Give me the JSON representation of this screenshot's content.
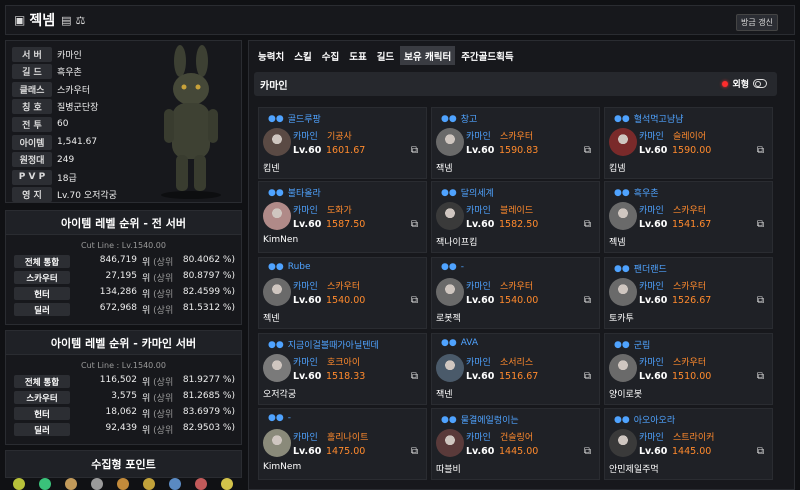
{
  "header": {
    "name": "젝넴",
    "refresh_label": "방금 갱신"
  },
  "profile": {
    "rows": [
      {
        "label": "서 버",
        "value": "카마인"
      },
      {
        "label": "길 드",
        "value": "흑우촌"
      },
      {
        "label": "클래스",
        "value": "스카우터"
      },
      {
        "label": "칭 호",
        "value": "질병군단장"
      },
      {
        "label": "전 투",
        "value": "60"
      },
      {
        "label": "아이템",
        "value": "1,541.67"
      },
      {
        "label": "원정대",
        "value": "249"
      },
      {
        "label": "P V P",
        "value": "18급"
      },
      {
        "label": "영 지",
        "value": "Lv.70 오저각궁"
      }
    ]
  },
  "rank_all": {
    "title": "아이템 레벨 순위 - 전 서버",
    "cutline": "Cut Line : Lv.1540.00",
    "rows": [
      {
        "label": "전체 통합",
        "value": "846,719",
        "unit": "위",
        "pre": "(상위",
        "pct": "80.4062 %)"
      },
      {
        "label": "스카우터",
        "value": "27,195",
        "unit": "위",
        "pre": "(상위",
        "pct": "80.8797 %)"
      },
      {
        "label": "헌터",
        "value": "134,286",
        "unit": "위",
        "pre": "(상위",
        "pct": "82.4599 %)"
      },
      {
        "label": "딜러",
        "value": "672,968",
        "unit": "위",
        "pre": "(상위",
        "pct": "81.5312 %)"
      }
    ]
  },
  "rank_server": {
    "title": "아이템 레벨 순위 - 카마인 서버",
    "cutline": "Cut Line : Lv.1540.00",
    "rows": [
      {
        "label": "전체 통합",
        "value": "116,502",
        "unit": "위",
        "pre": "(상위",
        "pct": "81.9277 %)"
      },
      {
        "label": "스카우터",
        "value": "3,575",
        "unit": "위",
        "pre": "(상위",
        "pct": "81.2685 %)"
      },
      {
        "label": "헌터",
        "value": "18,062",
        "unit": "위",
        "pre": "(상위",
        "pct": "83.6979 %)"
      },
      {
        "label": "딜러",
        "value": "92,439",
        "unit": "위",
        "pre": "(상위",
        "pct": "82.9503 %)"
      }
    ]
  },
  "collect": {
    "title": "수집형 포인트"
  },
  "tabs": [
    "능력치",
    "스킬",
    "수집",
    "도표",
    "길드",
    "보유 캐릭터",
    "주간골드획득"
  ],
  "active_tab": "보유 캐릭터",
  "server_bar": {
    "server": "카마인",
    "toggle_label": "외형"
  },
  "cards": [
    {
      "guild": "골드루팡",
      "server": "카마인",
      "cls": "기공사",
      "lv": "Lv.60",
      "ilvl": "1601.67",
      "name": "킴넨",
      "pc": "#5a4a44"
    },
    {
      "guild": "창고",
      "server": "카마인",
      "cls": "스카우터",
      "lv": "Lv.60",
      "ilvl": "1590.83",
      "name": "잭넴",
      "pc": "#6a6a6a"
    },
    {
      "guild": "혈석먹고냠냠",
      "server": "카마인",
      "cls": "슬레이어",
      "lv": "Lv.60",
      "ilvl": "1590.00",
      "name": "킴넴",
      "pc": "#7a2a2a"
    },
    {
      "guild": "불타올라",
      "server": "카마인",
      "cls": "도화가",
      "lv": "Lv.60",
      "ilvl": "1587.50",
      "name": "KimNen",
      "pc": "#b08a88"
    },
    {
      "guild": "달의세계",
      "server": "카마인",
      "cls": "블레이드",
      "lv": "Lv.60",
      "ilvl": "1582.50",
      "name": "잭나이프킴",
      "pc": "#3a3a3a"
    },
    {
      "guild": "흑우촌",
      "server": "카마인",
      "cls": "스카우터",
      "lv": "Lv.60",
      "ilvl": "1541.67",
      "name": "젝넴",
      "pc": "#6a6a6a"
    },
    {
      "guild": "Rube",
      "server": "카마인",
      "cls": "스카우터",
      "lv": "Lv.60",
      "ilvl": "1540.00",
      "name": "젝넨",
      "pc": "#6a6a6a"
    },
    {
      "guild": "-",
      "server": "카마인",
      "cls": "스카우터",
      "lv": "Lv.60",
      "ilvl": "1540.00",
      "name": "로봇젝",
      "pc": "#6a6a6a"
    },
    {
      "guild": "팬더랜드",
      "server": "카마인",
      "cls": "스카우터",
      "lv": "Lv.60",
      "ilvl": "1526.67",
      "name": "토카투",
      "pc": "#6a6a6a"
    },
    {
      "guild": "지금이걸볼때가아닐텐데",
      "server": "카마인",
      "cls": "호크아이",
      "lv": "Lv.60",
      "ilvl": "1518.33",
      "name": "오저각궁",
      "pc": "#7a7a7a"
    },
    {
      "guild": "AVA",
      "server": "카마인",
      "cls": "소서리스",
      "lv": "Lv.60",
      "ilvl": "1516.67",
      "name": "잭넨",
      "pc": "#4a5a6a"
    },
    {
      "guild": "군림",
      "server": "카마인",
      "cls": "스카우터",
      "lv": "Lv.60",
      "ilvl": "1510.00",
      "name": "양이로봇",
      "pc": "#6a6a6a"
    },
    {
      "guild": "-",
      "server": "카마인",
      "cls": "홀리나이트",
      "lv": "Lv.60",
      "ilvl": "1475.00",
      "name": "KimNem",
      "pc": "#8a8a7a"
    },
    {
      "guild": "물결에일렁이는",
      "server": "카마인",
      "cls": "건슬링어",
      "lv": "Lv.60",
      "ilvl": "1445.00",
      "name": "따블비",
      "pc": "#5a3a3a"
    },
    {
      "guild": "아오아오라",
      "server": "카마인",
      "cls": "스트라이커",
      "lv": "Lv.60",
      "ilvl": "1445.00",
      "name": "안민제일주먹",
      "pc": "#3a3a3a"
    }
  ]
}
